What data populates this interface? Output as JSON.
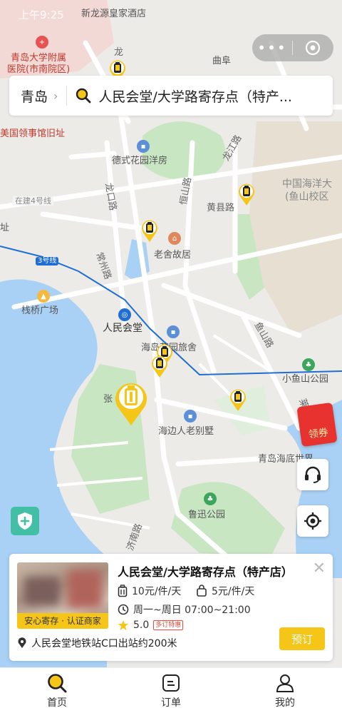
{
  "status_bar": {
    "time": "上午9:25"
  },
  "search": {
    "city": "青岛",
    "query": "人民会堂/大学路寄存点（特产..."
  },
  "map": {
    "labels": {
      "hotel": "新龙源皇家酒店",
      "hospital_1": "青岛大学附属",
      "hospital_2": "医院(市南院区)",
      "qufu": "曲阜",
      "long": "龙",
      "consulate": "美国领事馆旧址",
      "dese": "德式花园洋房",
      "longjiang_road": "龙江路",
      "hengshan_road": "恒山路",
      "huangxian_road": "黄县路",
      "ocean_univ_1": "中国海洋大",
      "ocean_univ_2": "(鱼山校区",
      "line4": "在建4号线",
      "site": "址",
      "longkou_road": "龙口路",
      "laoshe": "老舍故居",
      "changzhou_road": "常州路",
      "line3": "3号线",
      "zhanqiao": "栈桥广场",
      "renmin_hall": "人民会堂",
      "yushan_road": "鱼山路",
      "garden_hotel": "海岛花园旅舍",
      "xiaoyushan": "小鱼山公园",
      "zhang": "张",
      "haibian": "海边人老别墅",
      "underwater_world": "青岛海底世界",
      "luxun": "鲁迅公园",
      "laiyang_road": "莱阳路",
      "jinan_road": "济南路"
    }
  },
  "capsule": {
    "more": "•••"
  },
  "coupon": {
    "label": "领券"
  },
  "card": {
    "badge": "安心寄存 · 认证商家",
    "title": "人民会堂/大学路寄存点（特产店）",
    "price_large": "10元/件/天",
    "price_small": "5元/件/天",
    "hours": "周一~周日 07:00~21:00",
    "discount_tag": "多订特惠",
    "rating": "5.0",
    "address": "人民会堂地铁站C口出站约200米",
    "book_label": "预订",
    "close": "✕"
  },
  "tabs": [
    {
      "label": "首页",
      "icon": "search-icon"
    },
    {
      "label": "订单",
      "icon": "order-icon"
    },
    {
      "label": "我的",
      "icon": "user-icon"
    }
  ],
  "colors": {
    "accent": "#f5c518",
    "metro_line": "#1f6ed4",
    "coupon": "#e8322f",
    "shield": "#42bfa4"
  }
}
